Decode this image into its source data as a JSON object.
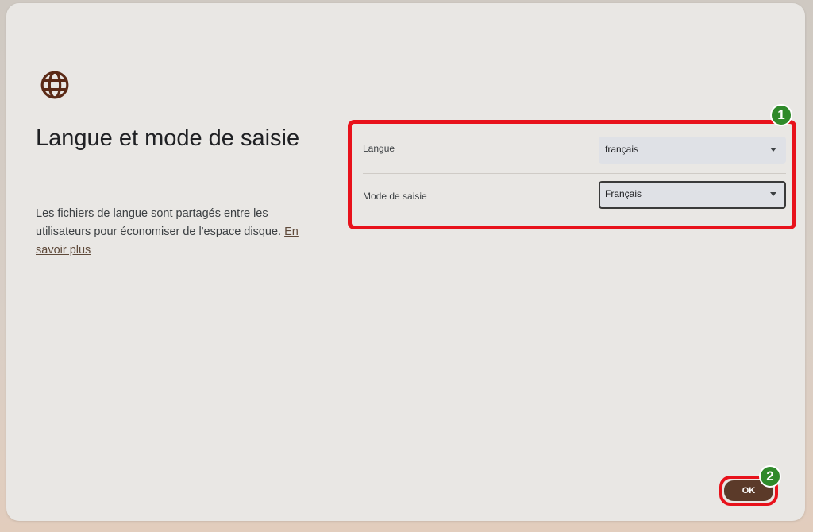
{
  "dialog": {
    "title": "Langue et mode de saisie",
    "description": "Les fichiers de langue sont partagés entre les utilisateurs pour économiser de l'espace disque.",
    "learn_more_link": "En savoir plus",
    "icon": "globe-icon"
  },
  "settings": {
    "language": {
      "label": "Langue",
      "value": "français"
    },
    "input_mode": {
      "label": "Mode de saisie",
      "value": "Français"
    }
  },
  "annotations": {
    "badge_1": "1",
    "badge_2": "2",
    "highlight_color": "#e8121b",
    "badge_color": "#2f8a2a"
  },
  "footer": {
    "ok_label": "OK"
  },
  "colors": {
    "accent": "#5b3a29"
  }
}
